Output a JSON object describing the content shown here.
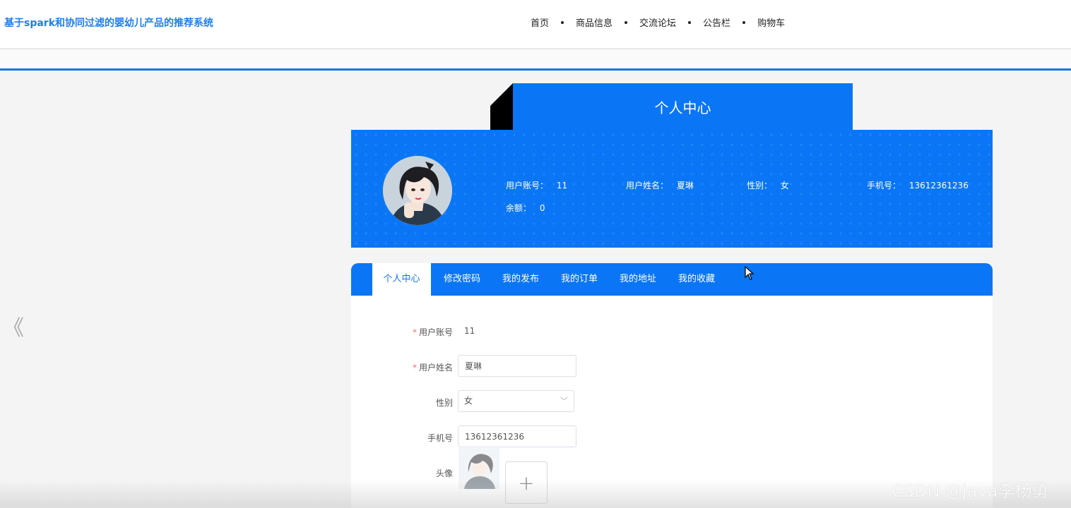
{
  "header": {
    "site_title": "基于spark和协同过滤的婴幼儿产品的推荐系统",
    "nav": [
      {
        "label": "首页"
      },
      {
        "label": "商品信息"
      },
      {
        "label": "交流论坛"
      },
      {
        "label": "公告栏"
      },
      {
        "label": "购物车"
      }
    ]
  },
  "page_title": "个人中心",
  "profile": {
    "account_label": "用户账号：",
    "account_value": "11",
    "name_label": "用户姓名：",
    "name_value": "夏琳",
    "gender_label": "性别：",
    "gender_value": "女",
    "phone_label": "手机号：",
    "phone_value": "13612361236",
    "balance_label": "余额：",
    "balance_value": "0"
  },
  "tabs": [
    {
      "label": "个人中心",
      "active": true
    },
    {
      "label": "修改密码"
    },
    {
      "label": "我的发布"
    },
    {
      "label": "我的订单"
    },
    {
      "label": "我的地址"
    },
    {
      "label": "我的收藏"
    }
  ],
  "form": {
    "required_mark": "*",
    "account_label": "用户账号",
    "account_value": "11",
    "name_label": "用户姓名",
    "name_value": "夏琳",
    "gender_label": "性别",
    "gender_value": "女",
    "phone_label": "手机号",
    "phone_value": "13612361236",
    "avatar_label": "头像",
    "upload_symbol": "+"
  },
  "icons": {
    "prev": "chevron-double-left-icon",
    "select": "chevron-down-icon",
    "cursor": "mouse-pointer-icon"
  },
  "watermark": "CSDN @java李杨勇",
  "colors": {
    "primary": "#0a76f5",
    "brand_title": "#1f7df0",
    "required": "#f56c6c"
  }
}
